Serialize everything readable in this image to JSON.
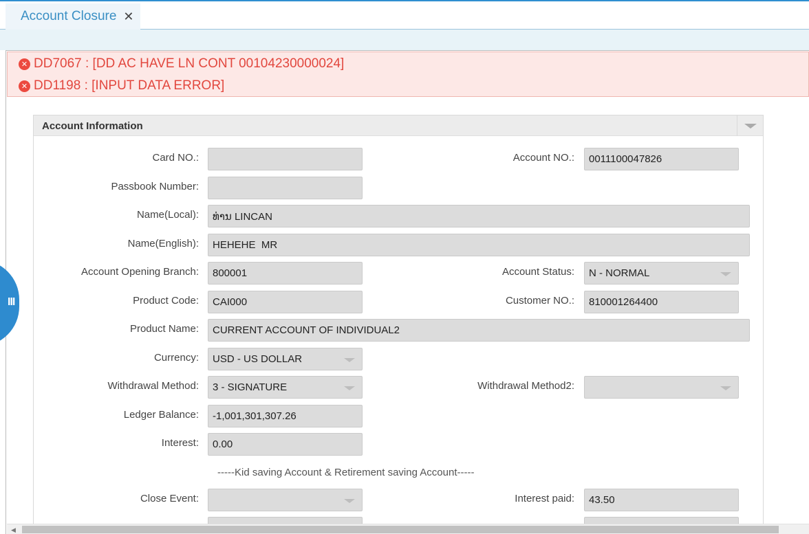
{
  "tab": {
    "title": "Account Closure",
    "close_glyph": "✕"
  },
  "errors": [
    {
      "icon": "✕",
      "text": "DD7067 : [DD AC HAVE LN CONT 00104230000024]"
    },
    {
      "icon": "✕",
      "text": "DD1198 : [INPUT DATA ERROR]"
    }
  ],
  "side_toggle": {
    "glyph": "III"
  },
  "panel": {
    "title": "Account Information"
  },
  "form": {
    "card_no": {
      "label": "Card NO.:",
      "value": ""
    },
    "account_no": {
      "label": "Account NO.:",
      "value": "0011100047826"
    },
    "passbook": {
      "label": "Passbook Number:",
      "value": ""
    },
    "name_local": {
      "label": "Name(Local):",
      "value": "ທ່ານ LINCAN"
    },
    "name_english": {
      "label": "Name(English):",
      "value": "HEHEHE  MR"
    },
    "opening_branch": {
      "label": "Account Opening Branch:",
      "value": "800001"
    },
    "account_status": {
      "label": "Account Status:",
      "value": "N - NORMAL"
    },
    "product_code": {
      "label": "Product Code:",
      "value": "CAI000"
    },
    "customer_no": {
      "label": "Customer NO.:",
      "value": "810001264400"
    },
    "product_name": {
      "label": "Product Name:",
      "value": "CURRENT ACCOUNT OF INDIVIDUAL2"
    },
    "currency": {
      "label": "Currency:",
      "value": "USD - US DOLLAR"
    },
    "withdrawal_method": {
      "label": "Withdrawal Method:",
      "value": "3 - SIGNATURE"
    },
    "withdrawal_method2": {
      "label": "Withdrawal Method2:",
      "value": ""
    },
    "ledger_balance": {
      "label": "Ledger Balance:",
      "value": "-1,001,301,307.26"
    },
    "interest": {
      "label": "Interest:",
      "value": "0.00"
    },
    "section_divider": "-----Kid saving Account & Retirement saving Account-----",
    "close_event": {
      "label": "Close Event:",
      "value": ""
    },
    "interest_paid": {
      "label": "Interest paid:",
      "value": "43.50"
    }
  },
  "colors": {
    "accent": "#2e8bcf",
    "error": "#e2473e",
    "error_bg": "#fde8e6",
    "field_bg": "#dcdcdc"
  }
}
